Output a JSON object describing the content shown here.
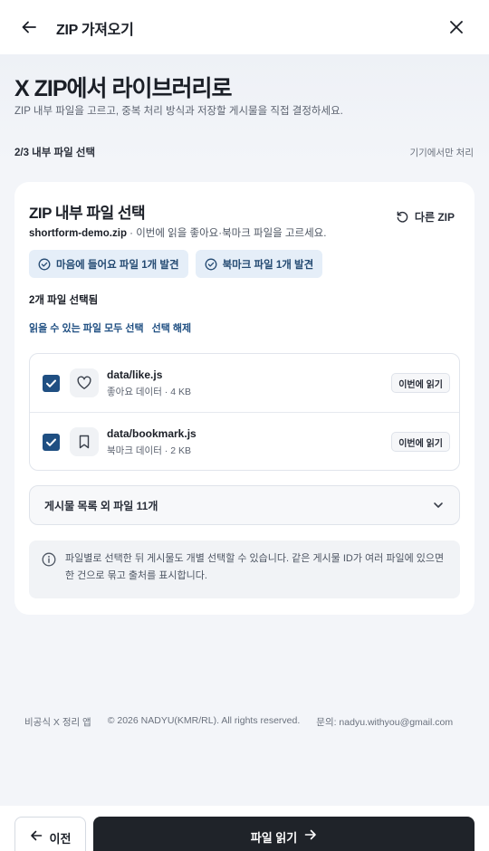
{
  "header": {
    "title": "ZIP 가져오기",
    "back_icon": "arrow-left-icon",
    "close_icon": "close-icon"
  },
  "intro": {
    "heading": "X ZIP에서 라이브러리로",
    "subheading": "ZIP 내부 파일을 고르고, 중복 처리 방식과 저장할 게시물을 직접 결정하세요.",
    "step": "2/3 내부 파일 선택",
    "device_only": "기기에서만 처리"
  },
  "card": {
    "title": "ZIP 내부 파일 선택",
    "other_zip_label": "다른 ZIP",
    "zip_name": "shortform-demo.zip",
    "zip_hint": " · 이번에 읽을 좋아요·북마크 파일을 고르세요.",
    "chips": [
      "마음에 들어요 파일 1개 발견",
      "북마크 파일 1개 발견"
    ],
    "selected_count": "2개 파일 선택됨",
    "select_all": "읽을 수 있는 파일 모두 선택",
    "deselect": "선택 해제",
    "files": [
      {
        "name": "data/like.js",
        "meta": "좋아요 데이터 · 4 KB",
        "badge": "이번에 읽기",
        "checked": true,
        "icon": "heart-icon"
      },
      {
        "name": "data/bookmark.js",
        "meta": "북마크 데이터 · 2 KB",
        "badge": "이번에 읽기",
        "checked": true,
        "icon": "bookmark-icon"
      }
    ],
    "more_label": "게시물 목록 외 파일 11개",
    "info": "파일별로 선택한 뒤 게시물도 개별 선택할 수 있습니다. 같은 게시물 ID가 여러 파일에 있으면 한 건으로 묶고 출처를 표시합니다."
  },
  "footer": {
    "app": "비공식 X 정리 앱",
    "copyright": "© 2026 NADYU(KMR/RL). All rights reserved.",
    "contact": "문의: nadyu.withyou@gmail.com"
  },
  "actions": {
    "prev": "이전",
    "read": "파일 읽기"
  },
  "colors": {
    "accent": "#1f4f82",
    "primary_button": "#1f2329",
    "chip_bg": "#e5eef8"
  }
}
